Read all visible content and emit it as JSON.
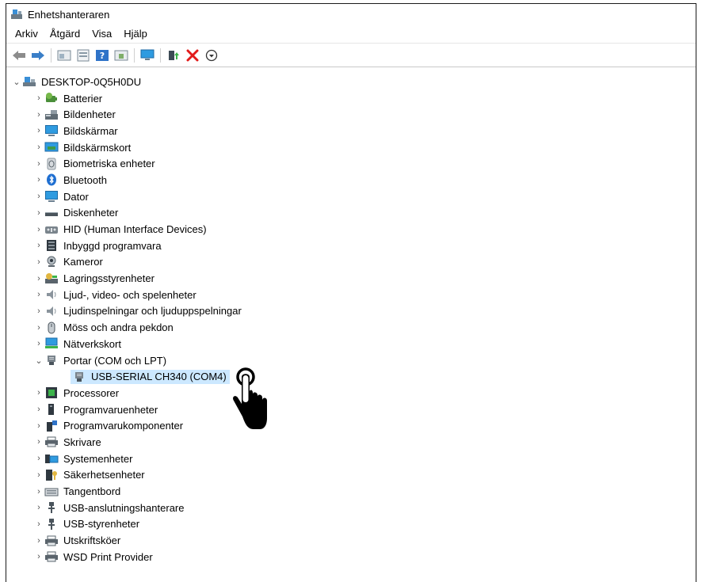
{
  "window": {
    "title": "Enhetshanteraren"
  },
  "menu": {
    "items": [
      "Arkiv",
      "Åtgärd",
      "Visa",
      "Hjälp"
    ]
  },
  "toolbar": {
    "icons": [
      "back-arrow-icon",
      "forward-arrow-icon",
      "properties-icon",
      "computer-view-icon",
      "help-icon",
      "details-icon",
      "monitor-scan-icon",
      "update-driver-icon",
      "uninstall-x-icon",
      "download-icon"
    ]
  },
  "tree": {
    "root": {
      "label": "DESKTOP-0Q5H0DU",
      "expanded": true
    },
    "categories": [
      {
        "label": "Batterier",
        "icon": "battery-icon"
      },
      {
        "label": "Bildenheter",
        "icon": "camera-imaging-icon"
      },
      {
        "label": "Bildskärmar",
        "icon": "monitor-icon"
      },
      {
        "label": "Bildskärmskort",
        "icon": "display-adapter-icon"
      },
      {
        "label": "Biometriska enheter",
        "icon": "fingerprint-icon"
      },
      {
        "label": "Bluetooth",
        "icon": "bluetooth-icon"
      },
      {
        "label": "Dator",
        "icon": "computer-icon"
      },
      {
        "label": "Diskenheter",
        "icon": "disk-drive-icon"
      },
      {
        "label": "HID (Human Interface Devices)",
        "icon": "hid-icon"
      },
      {
        "label": "Inbyggd programvara",
        "icon": "firmware-icon"
      },
      {
        "label": "Kameror",
        "icon": "webcam-icon"
      },
      {
        "label": "Lagringsstyrenheter",
        "icon": "storage-controller-icon"
      },
      {
        "label": "Ljud-, video- och spelenheter",
        "icon": "speaker-icon"
      },
      {
        "label": "Ljudinspelningar och ljuduppspelningar",
        "icon": "speaker-icon"
      },
      {
        "label": "Möss och andra pekdon",
        "icon": "mouse-icon"
      },
      {
        "label": "Nätverkskort",
        "icon": "network-adapter-icon"
      },
      {
        "label": "Portar (COM och LPT)",
        "icon": "port-icon",
        "expanded": true,
        "children": [
          {
            "label": "USB-SERIAL CH340 (COM4)",
            "icon": "port-icon",
            "selected": true
          }
        ]
      },
      {
        "label": "Processorer",
        "icon": "processor-icon"
      },
      {
        "label": "Programvaruenheter",
        "icon": "software-device-icon"
      },
      {
        "label": "Programvarukomponenter",
        "icon": "software-component-icon"
      },
      {
        "label": "Skrivare",
        "icon": "printer-icon"
      },
      {
        "label": "Systemenheter",
        "icon": "system-device-icon"
      },
      {
        "label": "Säkerhetsenheter",
        "icon": "security-device-icon"
      },
      {
        "label": "Tangentbord",
        "icon": "keyboard-icon"
      },
      {
        "label": "USB-anslutningshanterare",
        "icon": "usb-icon"
      },
      {
        "label": "USB-styrenheter",
        "icon": "usb-icon"
      },
      {
        "label": "Utskriftsköer",
        "icon": "printer-icon"
      },
      {
        "label": "WSD Print Provider",
        "icon": "printer-icon"
      }
    ]
  },
  "colors": {
    "selection": "#cce8ff",
    "accent_blue": "#2f9be0",
    "uninstall_red": "#e21a1a"
  }
}
